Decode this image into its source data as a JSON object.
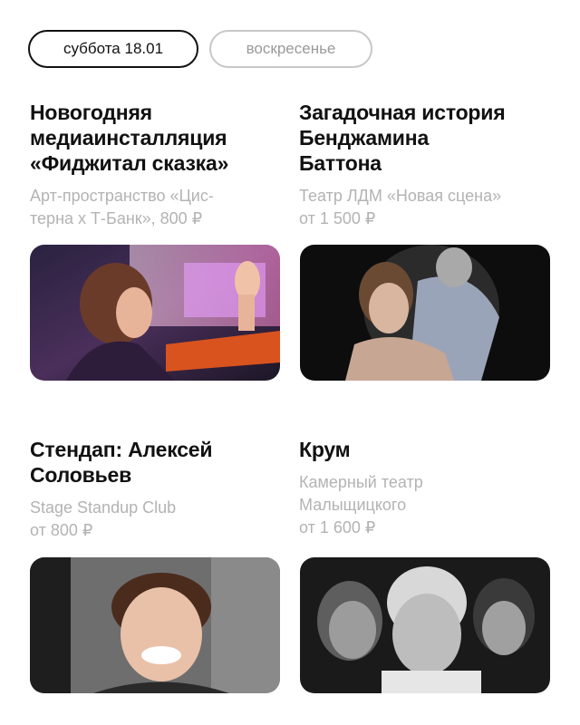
{
  "date_tabs": [
    {
      "label": "суббота 18.01",
      "active": true
    },
    {
      "label": "воскресенье",
      "active": false
    }
  ],
  "events": [
    {
      "title_lines": [
        "Новогодняя",
        "медиаинсталляция",
        "«Фиджитал сказка»"
      ],
      "meta_lines": [
        "Арт-пространство «Цис-",
        "терна х Т-Банк», 800 ₽"
      ],
      "image": "girl-touching-screen-photo"
    },
    {
      "title_lines": [
        "Загадочная история",
        "Бенджамина",
        "Баттона"
      ],
      "meta_lines": [
        "Театр ЛДМ «Новая сцена»",
        "от 1 500 ₽"
      ],
      "image": "theatre-embrace-photo"
    },
    {
      "title_lines": [
        "Стендап: Алексей",
        "Соловьев"
      ],
      "meta_lines": [
        "Stage Standup Club",
        "от 800 ₽"
      ],
      "image": "comedian-portrait-photo"
    },
    {
      "title_lines": [
        "Крум"
      ],
      "meta_lines": [
        "Камерный театр",
        "Малыщицкого",
        "от 1 600 ₽"
      ],
      "image": "actors-bw-photo"
    }
  ],
  "colors": {
    "text": "#111111",
    "muted": "#b3b3b3",
    "inactive_tab_border": "#c8c8c8",
    "background": "#ffffff"
  }
}
